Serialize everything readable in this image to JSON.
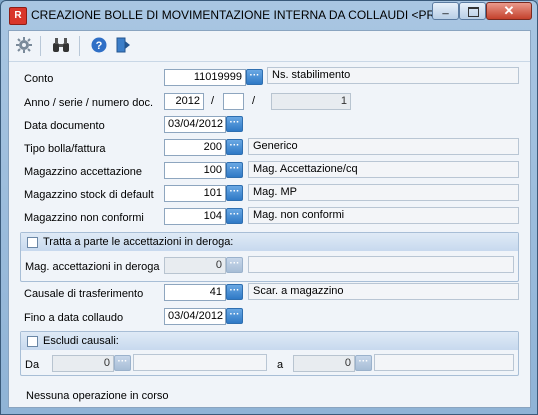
{
  "window": {
    "title": "CREAZIONE BOLLE DI MOVIMENTAZIONE INTERNA DA COLLAUDI <PRO...",
    "app_icon_letter": "R",
    "close_glyph": "✕",
    "min_glyph": "_"
  },
  "toolbar": {
    "icons": [
      "gear-icon",
      "binoculars-icon",
      "help-icon",
      "exit-icon"
    ]
  },
  "form": {
    "conto_label": "Conto",
    "conto_value": "11019999",
    "conto_desc": "Ns. stabilimento",
    "anno_label": "Anno / serie / numero doc.",
    "anno_value": "2012",
    "serie_value": "",
    "numero_value": "1",
    "slash": "/",
    "data_doc_label": "Data documento",
    "data_doc_value": "03/04/2012",
    "tipo_label": "Tipo bolla/fattura",
    "tipo_value": "200",
    "tipo_desc": "Generico",
    "mag_acc_label": "Magazzino accettazione",
    "mag_acc_value": "100",
    "mag_acc_desc": "Mag. Accettazione/cq",
    "mag_stock_label": "Magazzino stock di default",
    "mag_stock_value": "101",
    "mag_stock_desc": "Mag. MP",
    "mag_nc_label": "Magazzino non conformi",
    "mag_nc_value": "104",
    "mag_nc_desc": "Mag. non conformi",
    "deroga_group_label": "Tratta a parte le accettazioni in deroga:",
    "mag_deroga_label": "Mag. accettazioni in deroga",
    "mag_deroga_value": "0",
    "mag_deroga_desc": "",
    "causale_label": "Causale di trasferimento",
    "causale_value": "41",
    "causale_desc": "Scar. a magazzino",
    "fino_label": "Fino a data collaudo",
    "fino_value": "03/04/2012",
    "escludi_group_label": "Escludi causali:",
    "da_label": "Da",
    "da_value": "0",
    "a_label": "a",
    "a_value": "0",
    "lookup_glyph": "···"
  },
  "status": {
    "text": "Nessuna operazione in corso"
  }
}
